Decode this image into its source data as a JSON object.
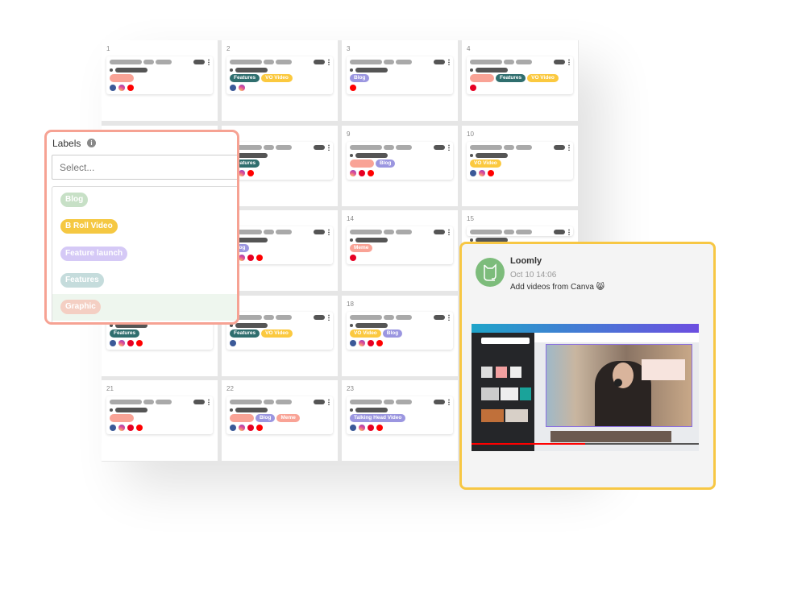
{
  "colors": {
    "salmon": "#f9a396",
    "features": "#2f6e6e",
    "vo": "#fbc93f",
    "blog": "#9b96e0",
    "labels_border": "#f6a293",
    "loomly_border": "#f7c744",
    "avatar": "#7dbc7b"
  },
  "calendar": {
    "cells": [
      {
        "day": "1",
        "tags": [
          {
            "text": "",
            "color": "#f9a396"
          }
        ],
        "icons": [
          "facebook",
          "instagram",
          "youtube"
        ]
      },
      {
        "day": "2",
        "tags": [
          {
            "text": "Features",
            "color": "#2f6e6e"
          },
          {
            "text": "VO Video",
            "color": "#fbc93f"
          }
        ],
        "icons": [
          "facebook",
          "instagram"
        ]
      },
      {
        "day": "3",
        "tags": [
          {
            "text": "Blog",
            "color": "#9b96e0"
          }
        ],
        "icons": [
          "youtube"
        ]
      },
      {
        "day": "4",
        "tags": [
          {
            "text": "",
            "color": "#f9a396"
          },
          {
            "text": "Features",
            "color": "#2f6e6e"
          },
          {
            "text": "VO Video",
            "color": "#fbc93f"
          }
        ],
        "icons": [
          "pinterest"
        ]
      },
      {
        "day": "",
        "tags": [],
        "icons": []
      },
      {
        "day": "",
        "tags": [
          {
            "text": "Features",
            "color": "#2f6e6e"
          }
        ],
        "icons": [
          "facebook",
          "instagram",
          "youtube"
        ]
      },
      {
        "day": "9",
        "tags": [
          {
            "text": "",
            "color": "#f9a396"
          },
          {
            "text": "Blog",
            "color": "#9b96e0"
          }
        ],
        "icons": [
          "instagram",
          "pinterest",
          "youtube"
        ]
      },
      {
        "day": "10",
        "tags": [
          {
            "text": "VO Video",
            "color": "#fbc93f"
          }
        ],
        "icons": [
          "facebook",
          "instagram",
          "youtube"
        ]
      },
      {
        "day": "",
        "tags": [],
        "icons": []
      },
      {
        "day": "",
        "tags": [
          {
            "text": "Blog",
            "color": "#9b96e0"
          }
        ],
        "icons": [
          "facebook",
          "instagram",
          "pinterest",
          "youtube"
        ]
      },
      {
        "day": "14",
        "tags": [
          {
            "text": "Meme",
            "color": "#f9a396"
          }
        ],
        "icons": [
          "pinterest"
        ]
      },
      {
        "day": "15",
        "tags": [],
        "icons": []
      },
      {
        "day": "",
        "tags": [
          {
            "text": "Features",
            "color": "#2f6e6e"
          }
        ],
        "icons": [
          "facebook",
          "instagram",
          "pinterest",
          "youtube"
        ]
      },
      {
        "day": "",
        "tags": [
          {
            "text": "Features",
            "color": "#2f6e6e"
          },
          {
            "text": "VO Video",
            "color": "#fbc93f"
          }
        ],
        "icons": [
          "facebook"
        ]
      },
      {
        "day": "18",
        "tags": [
          {
            "text": "VO Video",
            "color": "#fbc93f"
          },
          {
            "text": "Blog",
            "color": "#9b96e0"
          }
        ],
        "icons": [
          "facebook",
          "instagram",
          "pinterest",
          "youtube"
        ]
      },
      {
        "day": "",
        "tags": [],
        "icons": []
      },
      {
        "day": "21",
        "tags": [
          {
            "text": "",
            "color": "#f9a396"
          }
        ],
        "icons": [
          "facebook",
          "instagram",
          "pinterest",
          "youtube"
        ]
      },
      {
        "day": "22",
        "tags": [
          {
            "text": "",
            "color": "#f9a396"
          },
          {
            "text": "Blog",
            "color": "#9b96e0"
          },
          {
            "text": "Meme",
            "color": "#f9a396"
          }
        ],
        "icons": [
          "facebook",
          "instagram",
          "pinterest",
          "youtube"
        ]
      },
      {
        "day": "23",
        "tags": [
          {
            "text": "Talking Head Video",
            "color": "#9b96e0"
          }
        ],
        "icons": [
          "facebook",
          "instagram",
          "pinterest",
          "youtube"
        ]
      },
      {
        "day": "",
        "tags": [],
        "icons": []
      }
    ]
  },
  "labels_panel": {
    "title": "Labels",
    "info_icon": "info-icon",
    "placeholder": "Select...",
    "options": [
      {
        "text": "Blog",
        "color": "#c7e0c6"
      },
      {
        "text": "B Roll Video",
        "color": "#f5c842"
      },
      {
        "text": "Feature launch",
        "color": "#d5c9f6"
      },
      {
        "text": "Features",
        "color": "#c5dcdc"
      },
      {
        "text": "Graphic",
        "color": "#f4cfc3",
        "highlighted": true
      }
    ]
  },
  "comment": {
    "author": "Loomly",
    "time": "Oct 10 14:06",
    "message": "Add videos from Canva 😸"
  }
}
